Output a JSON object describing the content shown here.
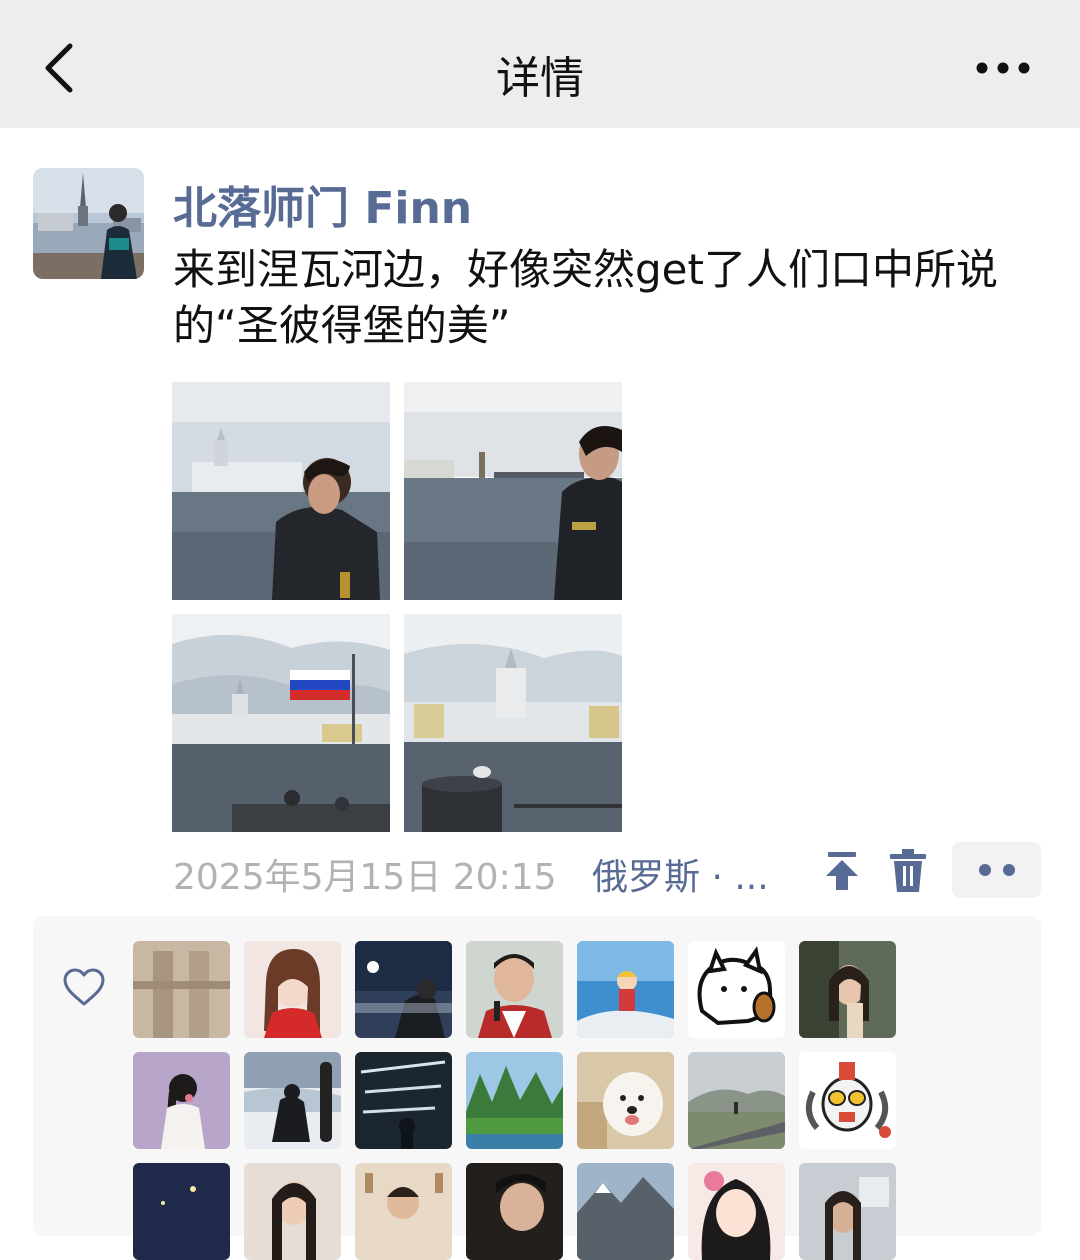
{
  "nav": {
    "title": "详情"
  },
  "post": {
    "author": "北落师门 Finn",
    "text": "来到涅瓦河边，好像突然get了人们口中所说的“圣彼得堡的美”",
    "timestamp": "2025年5月15日 20:15",
    "location": "俄罗斯 · ...",
    "photos": [
      "photo-river-portrait-1",
      "photo-river-portrait-2",
      "photo-russian-flag",
      "photo-kunstkamera"
    ]
  },
  "likes": {
    "avatar_count": 21
  },
  "icons": {
    "back": "chevron-left-icon",
    "more": "more-dots-icon",
    "pin": "pin-to-top-icon",
    "delete": "trash-icon",
    "like": "heart-icon"
  },
  "colors": {
    "nav_background": "#ededed",
    "link_blue": "#576b95",
    "timestamp_gray": "#b2b2b2",
    "likes_background": "#f7f7f7"
  }
}
